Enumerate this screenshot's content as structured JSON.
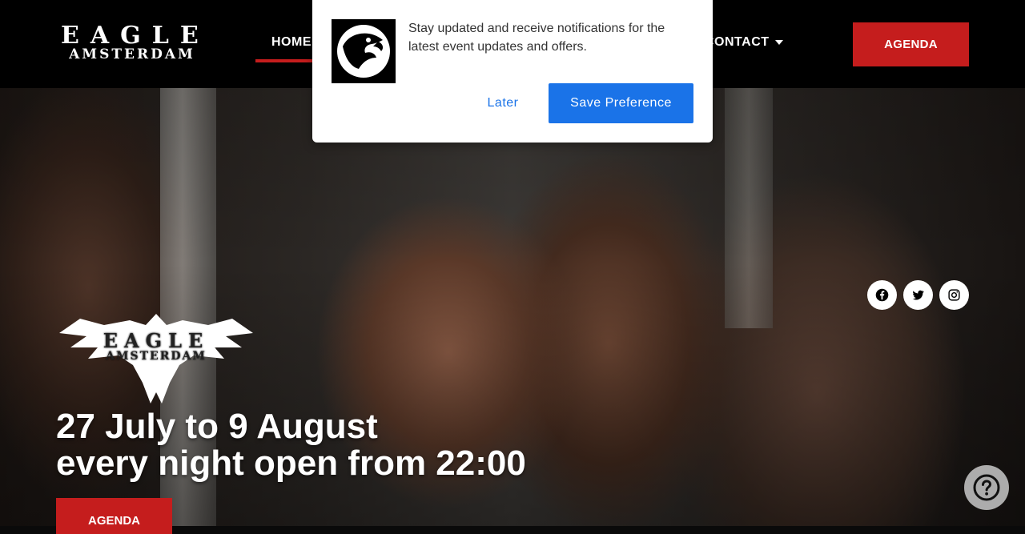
{
  "header": {
    "logo": {
      "line1": "EAGLE",
      "line2": "AMSTERDAM"
    },
    "nav": {
      "home": "HOME",
      "contact": "CONTACT"
    },
    "agenda_button": "AGENDA"
  },
  "popup": {
    "message": "Stay updated and receive notifications for the latest event updates and offers.",
    "later_label": "Later",
    "save_label": "Save Preference",
    "icon": "eagle-head-icon"
  },
  "hero": {
    "logo": {
      "line1": "EAGLE",
      "line2": "AMSTERDAM"
    },
    "headline_line1": "27 July to 9 August",
    "headline_line2": "every night open from 22:00",
    "agenda_button": "AGENDA",
    "social": [
      "facebook-icon",
      "twitter-icon",
      "instagram-icon"
    ]
  },
  "colors": {
    "accent_red": "#c51d1d",
    "popup_blue": "#1a73e8",
    "header_bg": "#000000"
  }
}
